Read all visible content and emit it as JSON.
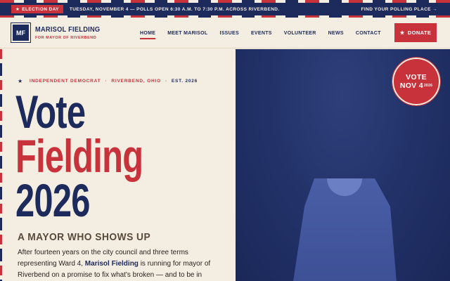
{
  "announce": {
    "badge": "Election Day",
    "text": "Tuesday, November 4 — Polls open 6:30 a.m. to 7:30 p.m. across Riverbend.",
    "link": "Find your polling place →"
  },
  "brand": {
    "initials": "MF",
    "name": "Marisol Fielding",
    "tagline": "For Mayor of Riverbend"
  },
  "nav": {
    "items": [
      "Home",
      "Meet Marisol",
      "Issues",
      "Events",
      "Volunteer",
      "News",
      "Contact"
    ],
    "active": "Home"
  },
  "donate": {
    "label": "Donate"
  },
  "hero": {
    "eyebrow": {
      "affiliation": "Independent Democrat",
      "place": "Riverbend, Ohio",
      "est": "Est. 2026"
    },
    "headline": [
      "Vote",
      "Fielding",
      "2026"
    ],
    "subhead": "A mayor who shows up",
    "body_before": "After fourteen years on the city council and three terms representing Ward 4, ",
    "body_name": "Marisol Fielding",
    "body_after": " is running for mayor of Riverbend on a promise to fix what's broken — and to be in"
  },
  "seal": {
    "line1": "Vote",
    "line2": "Nov 4",
    "sup": "2026"
  },
  "colors": {
    "navy": "#1c2a5c",
    "red": "#c8323a",
    "cream": "#f4ede1"
  },
  "icons": {
    "badge": "star-icon",
    "donate": "star-icon",
    "eyebrow": "star-icon"
  }
}
